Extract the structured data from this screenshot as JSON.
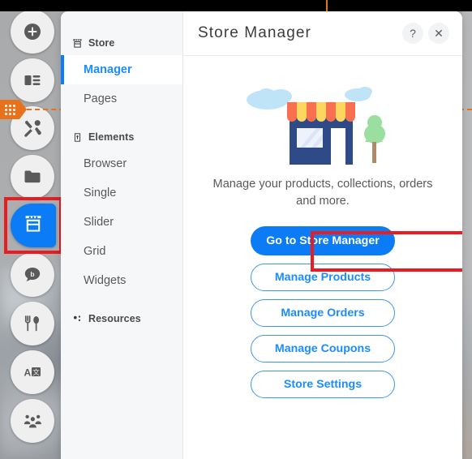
{
  "window": {
    "title": "Store Manager",
    "help_label": "?",
    "close_label": "✕"
  },
  "sidebar": {
    "groups": [
      {
        "label": "Store",
        "icon": "store-icon",
        "items": [
          {
            "label": "Manager",
            "active": true
          },
          {
            "label": "Pages",
            "active": false
          }
        ]
      },
      {
        "label": "Elements",
        "icon": "tag-icon",
        "items": [
          {
            "label": "Browser",
            "active": false
          },
          {
            "label": "Single",
            "active": false
          },
          {
            "label": "Slider",
            "active": false
          },
          {
            "label": "Grid",
            "active": false
          },
          {
            "label": "Widgets",
            "active": false
          }
        ]
      },
      {
        "label": "Resources",
        "icon": "dots-cluster-icon",
        "items": []
      }
    ]
  },
  "main": {
    "illustration": "storefront-illustration",
    "description": "Manage your products, collections, orders and more.",
    "primary_button": "Go to Store Manager",
    "secondary_buttons": [
      "Manage Products",
      "Manage Orders",
      "Manage Coupons",
      "Store Settings"
    ]
  },
  "toolbar": {
    "buttons": [
      {
        "name": "add-button",
        "icon": "plus-circle-icon"
      },
      {
        "name": "layout-button",
        "icon": "layout-icon"
      },
      {
        "name": "tools-button",
        "icon": "tools-icon"
      },
      {
        "name": "folder-button",
        "icon": "folder-icon"
      },
      {
        "name": "store-button",
        "icon": "store-icon",
        "active": true
      },
      {
        "name": "blog-button",
        "icon": "chat-bubble-b-icon"
      },
      {
        "name": "restaurant-button",
        "icon": "fork-spoon-icon"
      },
      {
        "name": "translate-button",
        "icon": "translate-icon"
      },
      {
        "name": "people-button",
        "icon": "people-group-icon"
      }
    ],
    "drag_handle": "drag-grip-handle"
  },
  "colors": {
    "accent": "#0b7cf5",
    "accent_text": "#1a8cff",
    "highlight": "#e71d22",
    "drag_handle": "#e8721b",
    "sidebar_bg": "#f6f7f8",
    "panel_bg": "#ffffff"
  }
}
